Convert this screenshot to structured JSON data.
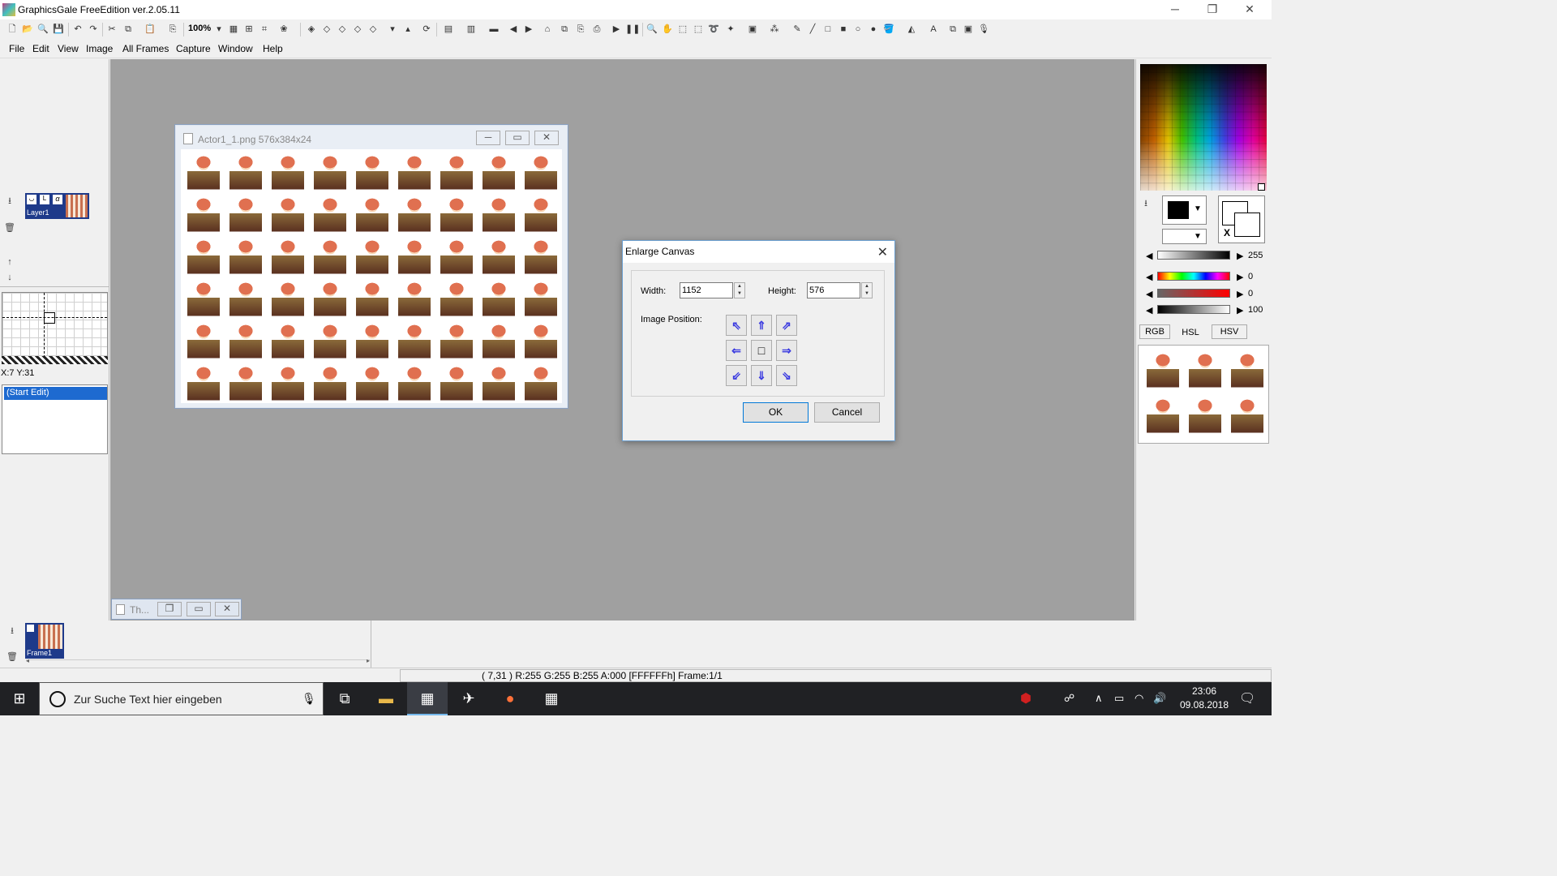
{
  "window": {
    "title": "GraphicsGale FreeEdition ver.2.05.11",
    "minimize": "─",
    "restore": "❐",
    "close": "✕"
  },
  "toolbar": {
    "zoom": "100%"
  },
  "menu": [
    "File",
    "Edit",
    "View",
    "Image",
    "All Frames",
    "Capture",
    "Window",
    "Help"
  ],
  "image_window": {
    "title": "Actor1_1.png 576x384x24"
  },
  "dialog": {
    "title": "Enlarge Canvas",
    "width_label": "Width:",
    "width_value": "1152",
    "height_label": "Height:",
    "height_value": "576",
    "image_position_label": "Image Position:",
    "ok": "OK",
    "cancel": "Cancel",
    "arrows": [
      "⇖",
      "⇑",
      "⇗",
      "⇐",
      "□",
      "⇒",
      "⇙",
      "⇓",
      "⇘"
    ]
  },
  "left_panel": {
    "layer_name": "Layer1",
    "coords": "X:7 Y:31",
    "history_item": "(Start Edit)"
  },
  "right_panel": {
    "values": [
      "255",
      "0",
      "0",
      "100"
    ],
    "tabs": [
      "RGB",
      "HSL",
      "HSV"
    ]
  },
  "bottom_panel": {
    "frame_name": "Frame1",
    "min_window_title": "Th..."
  },
  "status": {
    "text": "( 7,31 ) R:255 G:255 B:255 A:000  [FFFFFFh]  Frame:1/1"
  },
  "taskbar": {
    "search_placeholder": "Zur Suche Text hier eingeben",
    "time": "23:06",
    "date": "09.08.2018"
  },
  "colors": {
    "accent": "#0078d7",
    "mdi_bg": "#a0a0a0",
    "selection": "#1e3a8a"
  }
}
